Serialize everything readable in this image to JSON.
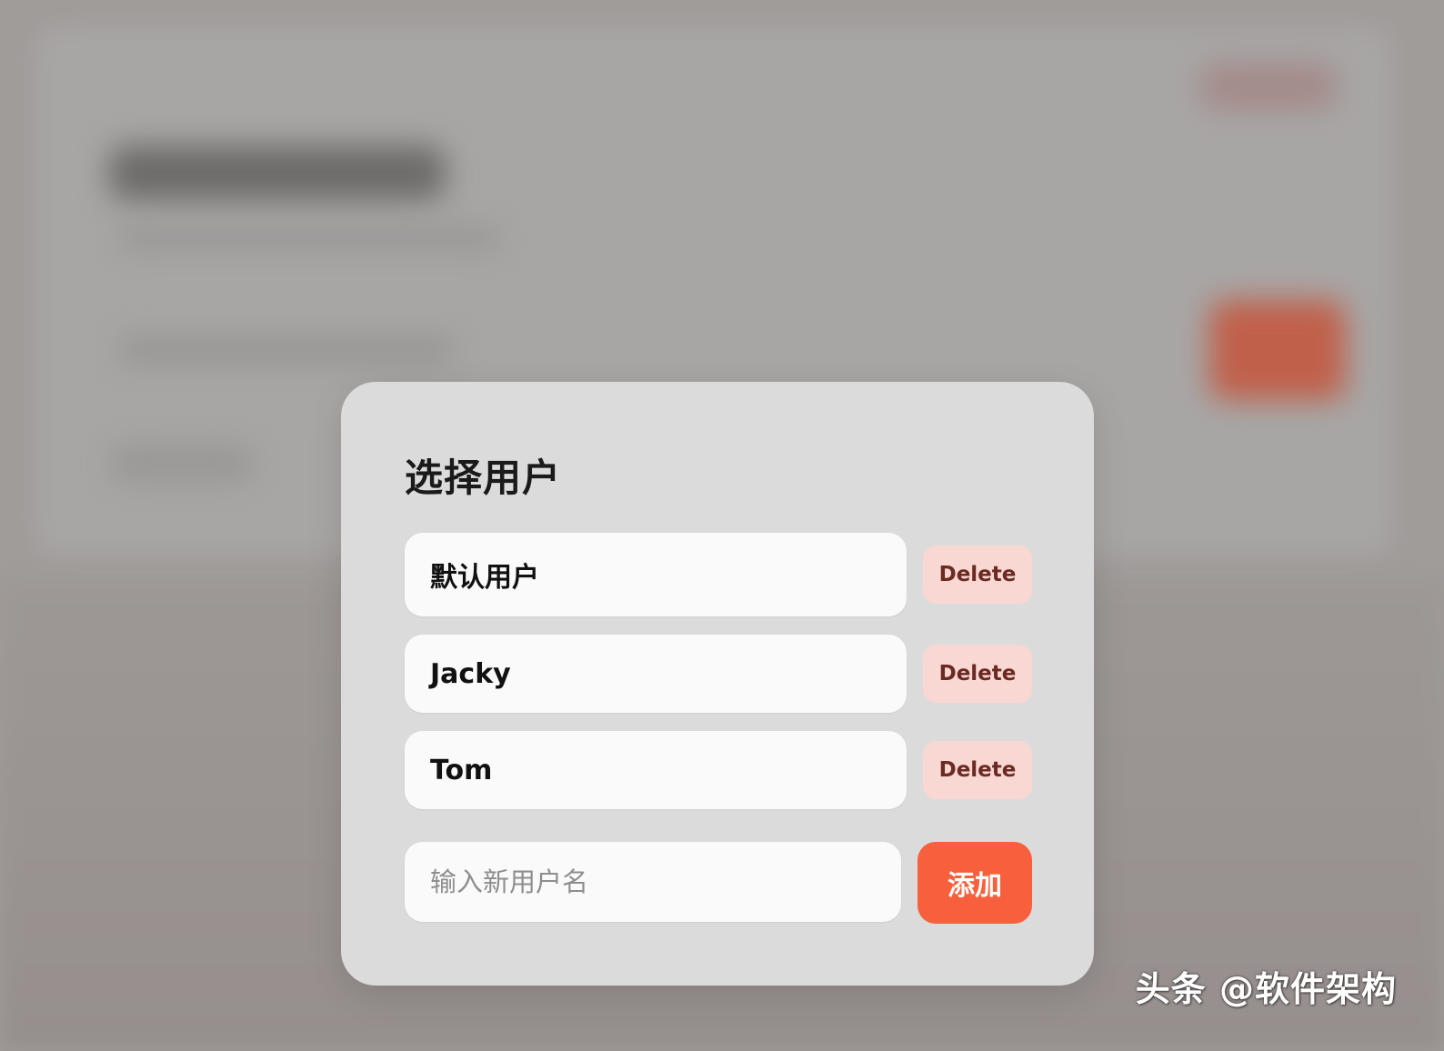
{
  "modal": {
    "title": "选择用户",
    "users": [
      {
        "name": "默认用户",
        "delete_label": "Delete"
      },
      {
        "name": "Jacky",
        "delete_label": "Delete"
      },
      {
        "name": "Tom",
        "delete_label": "Delete"
      }
    ],
    "new_user": {
      "placeholder": "输入新用户名",
      "value": "",
      "add_label": "添加"
    }
  },
  "watermark": {
    "text": "头条 @软件架构"
  },
  "colors": {
    "accent": "#f85f3d",
    "delete_bg": "#f9d7d2",
    "delete_text": "#6b2a22",
    "modal_bg": "#dcdbdb",
    "field_bg": "#fafafa"
  }
}
